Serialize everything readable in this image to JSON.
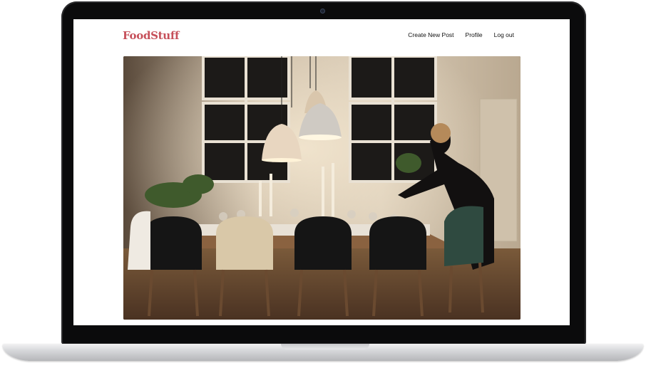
{
  "app": {
    "logo": "FoodStuff"
  },
  "nav": {
    "items": [
      {
        "label": "Create New Post"
      },
      {
        "label": "Profile"
      },
      {
        "label": "Log out"
      }
    ]
  },
  "hero": {
    "icon": "dinner-table-photo"
  },
  "colors": {
    "brand": "#c6505a",
    "nav_text": "#111111",
    "background": "#ffffff"
  }
}
